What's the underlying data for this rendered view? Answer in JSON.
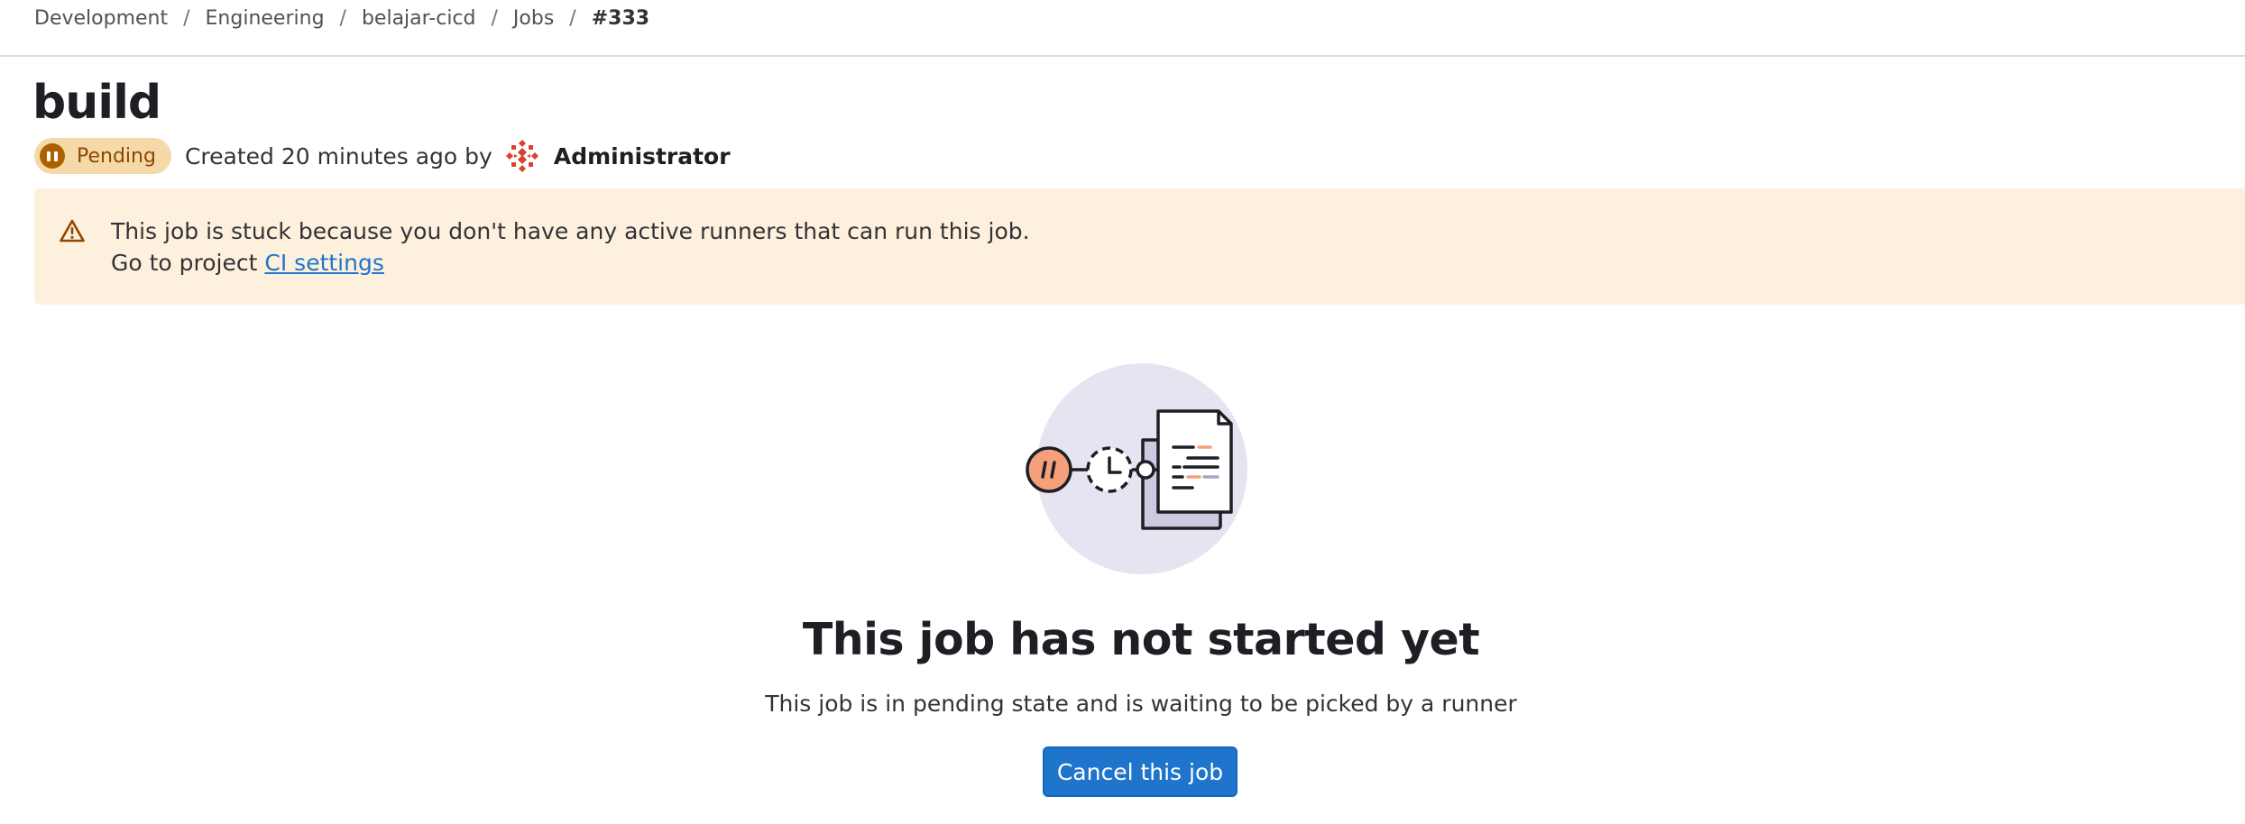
{
  "breadcrumb": {
    "items": [
      "Development",
      "Engineering",
      "belajar-cicd",
      "Jobs"
    ],
    "current": "#333",
    "separator": "/"
  },
  "job": {
    "name": "build",
    "status": "Pending",
    "created_text": "Created 20 minutes ago by",
    "author": "Administrator"
  },
  "alert": {
    "message": "This job is stuck because you don't have any active runners that can run this job.",
    "prefix": "Go to project",
    "link_text": "CI settings"
  },
  "empty_state": {
    "title": "This job has not started yet",
    "description": "This job is in pending state and is waiting to be picked by a runner",
    "button_label": "Cancel this job"
  },
  "icons": {
    "status": "pause-icon",
    "alert": "warning-icon",
    "avatar": "identicon-avatar",
    "illustration": "pending-job-illustration"
  },
  "colors": {
    "primary": "#1f75cb",
    "pending_badge_bg": "#f5d9a8",
    "pending_badge_text": "#8f4700",
    "alert_bg": "#fdf1dd",
    "illustration_circle": "#e6e4f0",
    "illustration_accent": "#f6a07b"
  }
}
